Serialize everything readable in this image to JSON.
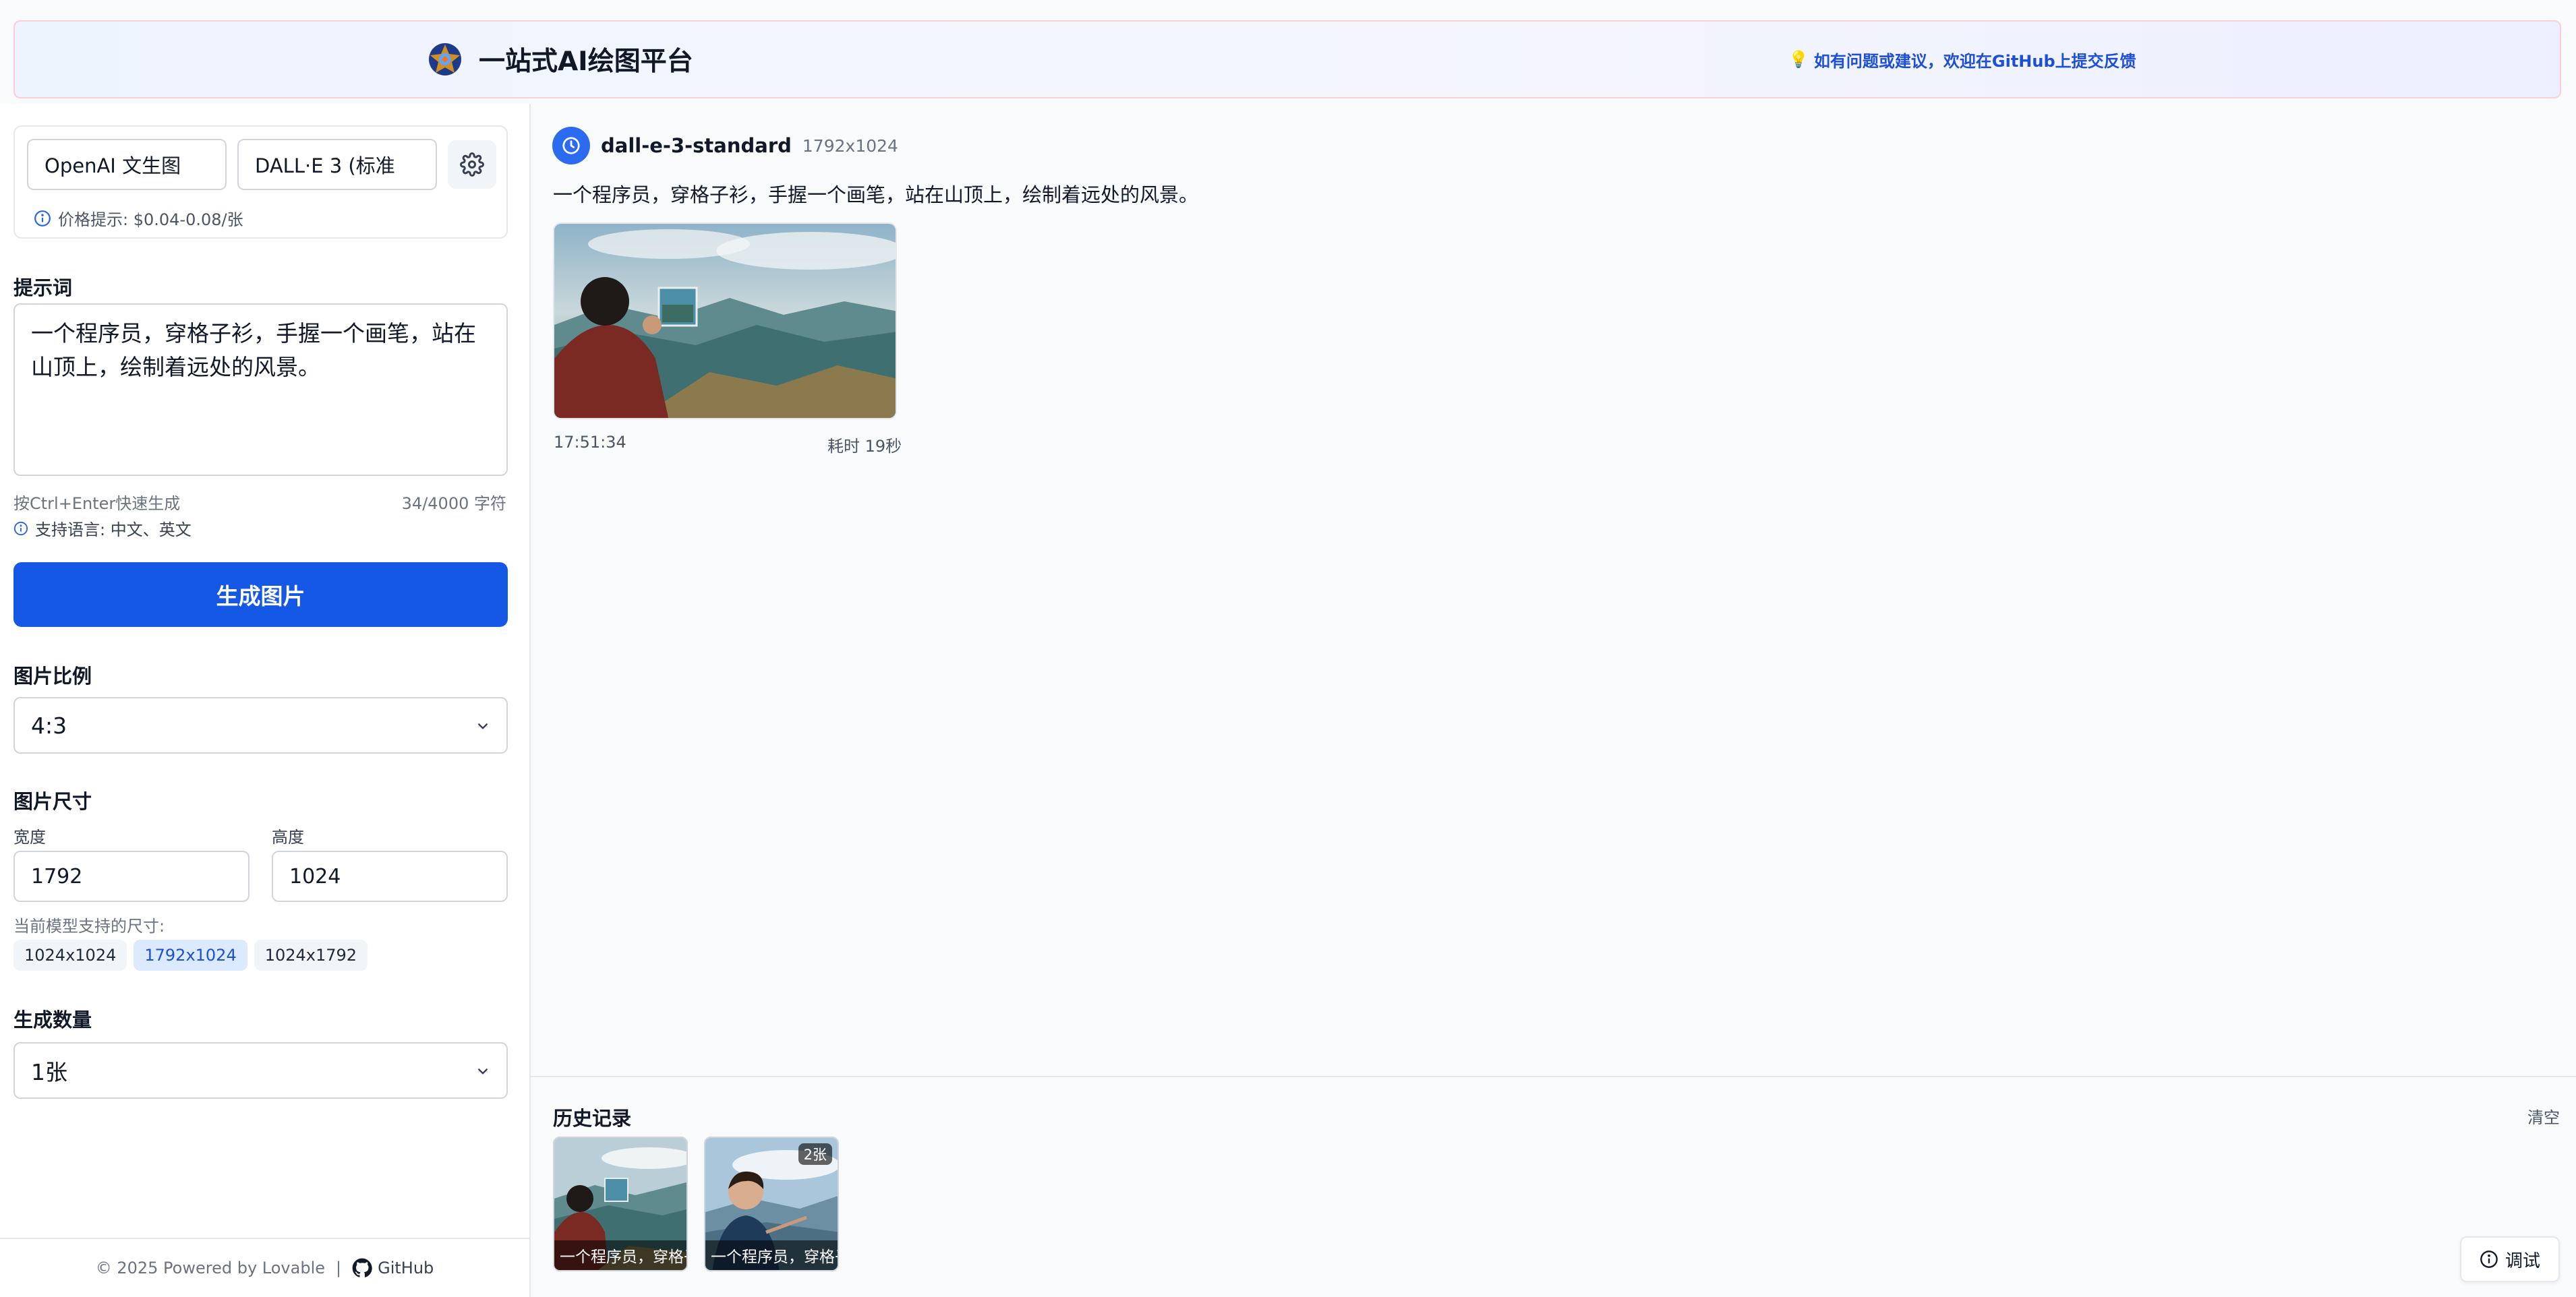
{
  "header": {
    "title": "一站式AI绘图平台",
    "feedback_icon": "lightbulb-icon",
    "feedback": "如有问题或建议，欢迎在GitHub上提交反馈"
  },
  "sidebar": {
    "provider": "OpenAI 文生图",
    "model": "DALL·E 3 (标准",
    "price_hint": "价格提示: $0.04-0.08/张",
    "prompt_label": "提示词",
    "prompt_value": "一个程序员，穿格子衫，手握一个画笔，站在山顶上，绘制着远处的风景。",
    "shortcut_hint": "按Ctrl+Enter快速生成",
    "char_count": "34/4000 字符",
    "lang_hint": "支持语言: 中文、英文",
    "generate_button": "生成图片",
    "ratio_label": "图片比例",
    "ratio_value": "4:3",
    "size_label": "图片尺寸",
    "width_label": "宽度",
    "width_value": "1792",
    "height_label": "高度",
    "height_value": "1024",
    "supported_label": "当前模型支持的尺寸:",
    "supported_sizes": [
      "1024x1024",
      "1792x1024",
      "1024x1792"
    ],
    "selected_size": "1792x1024",
    "count_label": "生成数量",
    "count_value": "1张",
    "footer_text": "© 2025 Powered by Lovable",
    "footer_sep": "|",
    "github": "GitHub"
  },
  "result": {
    "model": "dall-e-3-standard",
    "size": "1792x1024",
    "prompt": "一个程序员，穿格子衫，手握一个画笔，站在山顶上，绘制着远处的风景。",
    "time": "17:51:34",
    "duration": "耗时 19秒"
  },
  "history": {
    "title": "历史记录",
    "clear": "清空",
    "items": [
      {
        "caption": "一个程序员，穿格子衫，手握一个画笔，站在山顶上"
      },
      {
        "caption": "一个程序员，穿格子衫，手握一个画笔，站在山顶上",
        "badge": "2张"
      }
    ]
  },
  "debug_button": "调试",
  "colors": {
    "primary": "#1558e5",
    "chip_active_bg": "#dbeafe",
    "chip_active_text": "#1d4ed8",
    "feedback_link": "#1d4ed8"
  }
}
